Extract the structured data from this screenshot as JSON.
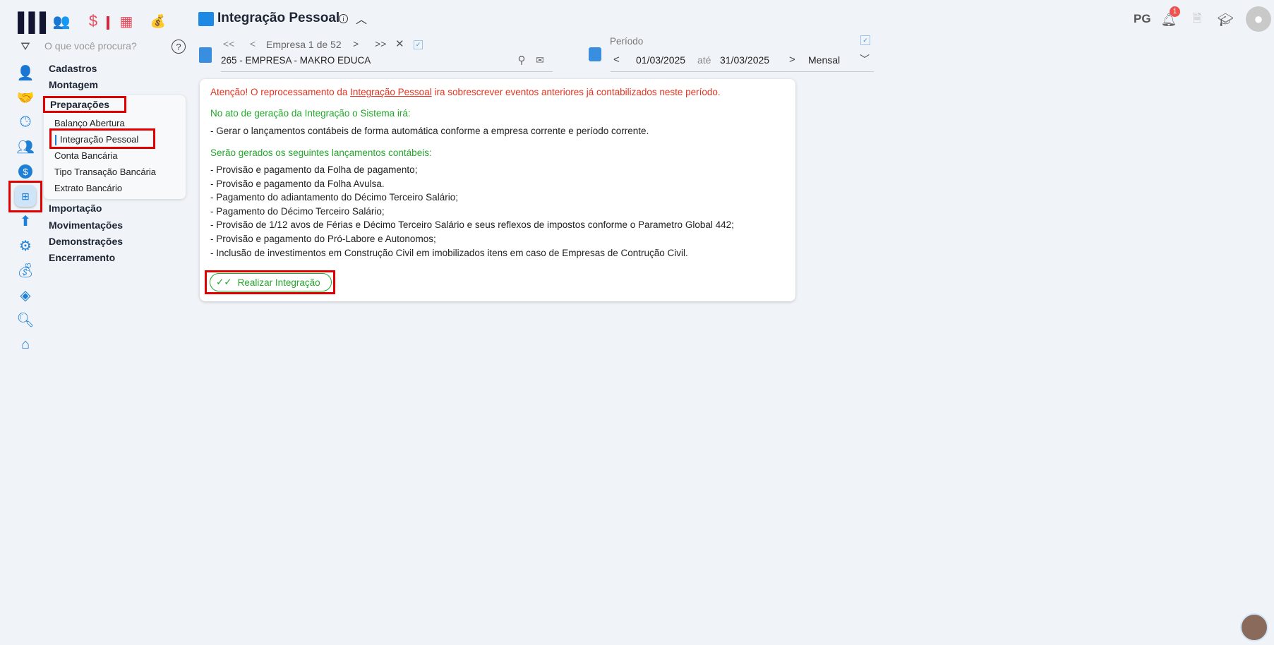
{
  "header": {
    "title": "Integração Pessoal",
    "user_initials": "PG",
    "notification_count": "1"
  },
  "search": {
    "placeholder": "O que você procura?"
  },
  "company": {
    "nav_label": "Empresa 1 de 52",
    "value": "265 - EMPRESA - MAKRO EDUCA"
  },
  "period": {
    "label": "Período",
    "start": "01/03/2025",
    "sep": "até",
    "end": "31/03/2025",
    "mode": "Mensal"
  },
  "menu": {
    "sections": [
      "Cadastros",
      "Montagem",
      "Preparações",
      "Importação",
      "Movimentações",
      "Demonstrações",
      "Encerramento"
    ],
    "submenu": [
      "Balanço Abertura",
      "Integração Pessoal",
      "Conta Bancária",
      "Tipo Transação Bancária",
      "Extrato Bancário"
    ]
  },
  "content": {
    "warning_pre": "Atenção! O reprocessamento da ",
    "warning_link": "Integração Pessoal",
    "warning_post": " ira sobrescrever eventos anteriores já contabilizados neste período.",
    "heading1": "No ato de geração da Integração o Sistema irá:",
    "list1": [
      "Gerar o lançamentos contábeis de forma automática conforme a empresa corrente e período corrente."
    ],
    "heading2": "Serão gerados os seguintes lançamentos contábeis:",
    "list2": [
      "Provisão e pagamento da Folha de pagamento;",
      "Provisão e pagamento da Folha Avulsa.",
      "Pagamento do adiantamento do Décimo Terceiro Salário;",
      "Pagamento do Décimo Terceiro Salário;",
      "Provisão de 1/12 avos de Férias e Décimo Terceiro Salário e seus reflexos de impostos conforme o Parametro Global 442;",
      "Provisão e pagamento do Pró-Labore e Autonomos;",
      "Inclusão de investimentos em Construção Civil em imobilizados itens em caso de Empresas de Contrução Civil."
    ],
    "button": "Realizar Integração"
  }
}
